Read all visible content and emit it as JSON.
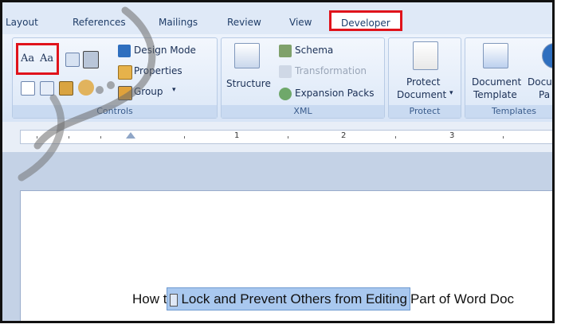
{
  "tabs": [
    "Layout",
    "References",
    "Mailings",
    "Review",
    "View",
    "Developer"
  ],
  "selected_tab": "Developer",
  "groups": {
    "controls": {
      "label": "Controls",
      "rich_text": "Aa",
      "plain_text": "Aa",
      "design_mode": "Design Mode",
      "properties": "Properties",
      "group": "Group"
    },
    "xml": {
      "label": "XML",
      "structure": "Structure",
      "schema": "Schema",
      "transformation": "Transformation",
      "expansion_packs": "Expansion Packs"
    },
    "protect": {
      "label": "Protect",
      "protect_document_line1": "Protect",
      "protect_document_line2": "Document"
    },
    "templates": {
      "label": "Templates",
      "document_template_line1": "Document",
      "document_template_line2": "Template",
      "document_panel_line1": "Docu",
      "document_panel_line2": "Pa"
    }
  },
  "ruler": {
    "numbers": [
      "1",
      "2",
      "3"
    ]
  },
  "document": {
    "text_before": "How t",
    "content_control_text": "Lock and Prevent Others from Editing",
    "text_after": "Part of Word Doc"
  },
  "colors": {
    "highlight_border": "#e0131b",
    "ribbon_bg": "#dbe7f7",
    "selected_control": "#a9c8ef"
  }
}
